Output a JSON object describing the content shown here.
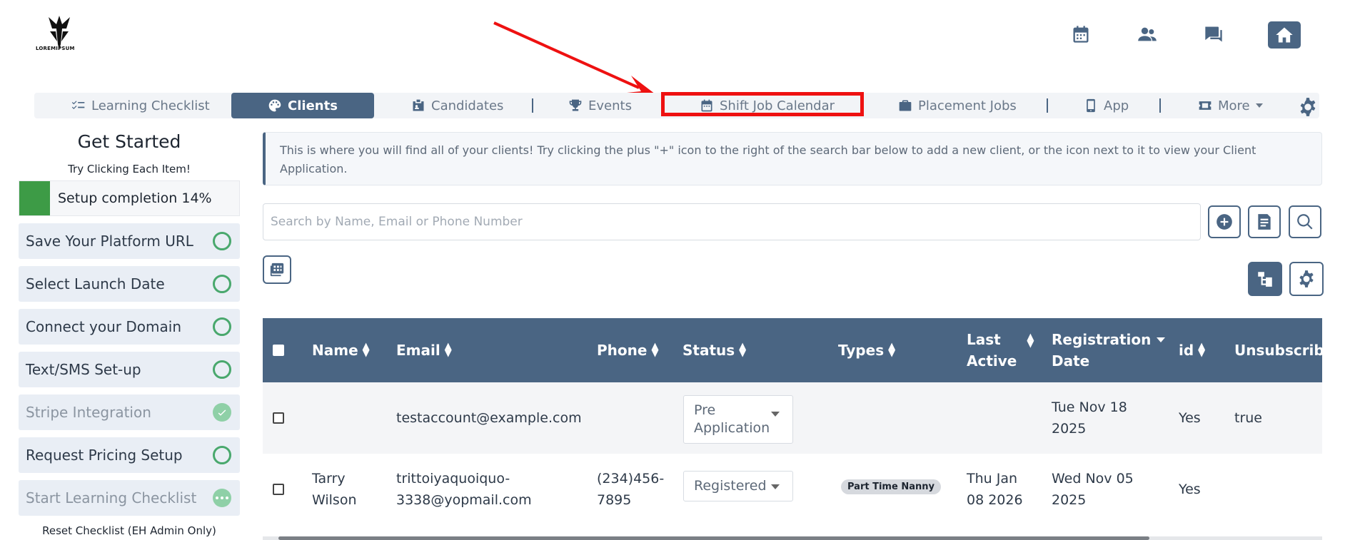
{
  "app": {
    "logo_text": "LOREMIPSUM"
  },
  "colors": {
    "primary": "#4a6583",
    "accent_green": "#3d9b46",
    "annotation_red": "#ee1111"
  },
  "header_icons": [
    "calendar-icon",
    "users-icon",
    "chat-icon",
    "home-icon"
  ],
  "nav": {
    "tabs": [
      {
        "label": "Learning Checklist",
        "icon": "checklist-icon",
        "active": false
      },
      {
        "label": "Clients",
        "icon": "palette-icon",
        "active": true
      },
      {
        "label": "Candidates",
        "icon": "id-badge-icon",
        "active": false
      },
      {
        "label": "Events",
        "icon": "trophy-icon",
        "active": false
      },
      {
        "label": "Shift Job Calendar",
        "icon": "calendar-icon",
        "active": false
      },
      {
        "label": "Placement Jobs",
        "icon": "briefcase-icon",
        "active": false
      },
      {
        "label": "App",
        "icon": "mobile-icon",
        "active": false
      },
      {
        "label": "More",
        "icon": "ticket-icon",
        "active": false
      }
    ],
    "settings_icon": "gear-icon"
  },
  "sidebar": {
    "title": "Get Started",
    "subtitle": "Try Clicking Each Item!",
    "progress_label": "Setup completion 14%",
    "progress_percent": 14,
    "items": [
      {
        "label": "Save Your Platform URL",
        "status": "pending"
      },
      {
        "label": "Select Launch Date",
        "status": "pending"
      },
      {
        "label": "Connect your Domain",
        "status": "pending"
      },
      {
        "label": "Text/SMS Set-up",
        "status": "pending"
      },
      {
        "label": "Stripe Integration",
        "status": "done"
      },
      {
        "label": "Request Pricing Setup",
        "status": "pending"
      },
      {
        "label": "Start Learning Checklist",
        "status": "in-progress"
      }
    ],
    "reset_label": "Reset Checklist (EH Admin Only)"
  },
  "main": {
    "info_text": "This is where you will find all of your clients! Try clicking the plus \"+\" icon to the right of the search bar below to add a new client, or the icon next to it to view your Client Application.",
    "search_placeholder": "Search by Name, Email or Phone Number",
    "table": {
      "headers": {
        "name": "Name",
        "email": "Email",
        "phone": "Phone",
        "status": "Status",
        "types": "Types",
        "last_active_1": "Last",
        "last_active_2": "Active",
        "registration_1": "Registration",
        "registration_2": "Date",
        "id": "id",
        "unsubscribed": "Unsubscribed"
      },
      "rows": [
        {
          "name_1": "",
          "name_2": "",
          "email_1": "testaccount@example.com",
          "email_2": "",
          "phone_1": "",
          "phone_2": "",
          "status_1": "Pre",
          "status_2": "Application",
          "type": "",
          "last_active_1": "",
          "last_active_2": "",
          "registration_1": "Tue Nov 18",
          "registration_2": "2025",
          "id": "Yes",
          "unsubscribed": "true"
        },
        {
          "name_1": "Tarry",
          "name_2": "Wilson",
          "email_1": "trittoiyaquoiquo-",
          "email_2": "3338@yopmail.com",
          "phone_1": "(234)456-",
          "phone_2": "7895",
          "status_1": "Registered",
          "status_2": "",
          "type": "Part Time Nanny",
          "last_active_1": "Thu Jan",
          "last_active_2": "08 2026",
          "registration_1": "Wed Nov 05",
          "registration_2": "2025",
          "id": "Yes",
          "unsubscribed": ""
        }
      ]
    }
  }
}
